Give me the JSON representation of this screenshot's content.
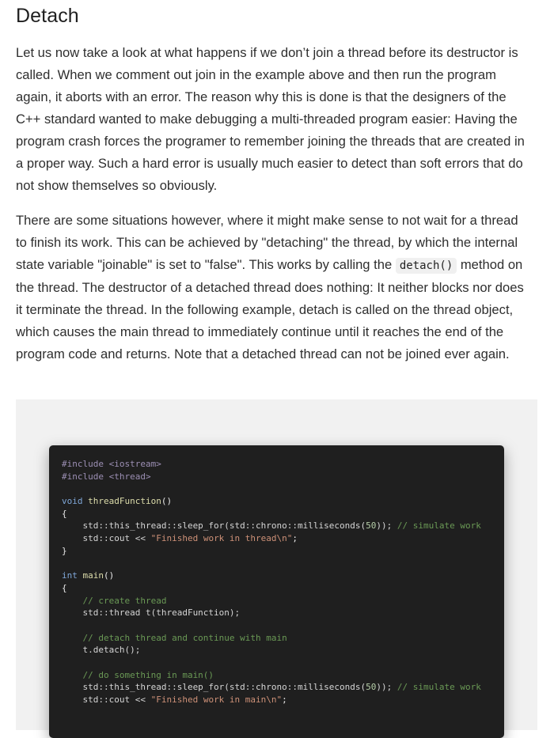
{
  "heading": "Detach",
  "paragraph1": "Let us now take a look at what happens if we don’t join a thread before its destructor is called. When we comment out join in the example above and then run the program again, it aborts with an error. The reason why this is done is that the designers of the C++ standard wanted to make debugging a multi-threaded program easier: Having the program crash forces the programer to remember joining the threads that are created in a proper way. Such a hard error is usually much easier to detect than soft errors that do not show themselves so obviously.",
  "paragraph2": {
    "before": "There are some situations however, where it might make sense to not wait for a thread to finish its work. This can be achieved by \"detaching\" the thread, by which the internal state variable \"joinable\" is set to \"false\". This works by calling the ",
    "code": "detach()",
    "after": " method on the thread. The destructor of a detached thread does nothing: It neither blocks nor does it terminate the thread. In the following example, detach is called on the thread object, which causes the main thread to immediately continue until it reaches the end of the program code and returns. Note that a detached thread can not be joined ever again."
  },
  "code_lines": [
    [
      {
        "t": "#include <iostream>",
        "c": "pp"
      }
    ],
    [
      {
        "t": "#include <thread>",
        "c": "pp"
      }
    ],
    [
      {
        "t": "",
        "c": ""
      }
    ],
    [
      {
        "t": "void",
        "c": "kw"
      },
      {
        "t": " ",
        "c": ""
      },
      {
        "t": "threadFunction",
        "c": "fn"
      },
      {
        "t": "()",
        "c": ""
      }
    ],
    [
      {
        "t": "{",
        "c": ""
      }
    ],
    [
      {
        "t": "    std::this_thread::sleep_for(std::chrono::milliseconds(",
        "c": "ns"
      },
      {
        "t": "50",
        "c": "num"
      },
      {
        "t": ")); ",
        "c": "ns"
      },
      {
        "t": "// simulate work",
        "c": "cm"
      }
    ],
    [
      {
        "t": "    std::cout << ",
        "c": "ns"
      },
      {
        "t": "\"Finished work in thread\\n\"",
        "c": "str"
      },
      {
        "t": ";",
        "c": ""
      }
    ],
    [
      {
        "t": "}",
        "c": ""
      }
    ],
    [
      {
        "t": "",
        "c": ""
      }
    ],
    [
      {
        "t": "int",
        "c": "kw"
      },
      {
        "t": " ",
        "c": ""
      },
      {
        "t": "main",
        "c": "fn"
      },
      {
        "t": "()",
        "c": ""
      }
    ],
    [
      {
        "t": "{",
        "c": ""
      }
    ],
    [
      {
        "t": "    // create thread",
        "c": "cm"
      }
    ],
    [
      {
        "t": "    std::thread t(threadFunction);",
        "c": "ns"
      }
    ],
    [
      {
        "t": "",
        "c": ""
      }
    ],
    [
      {
        "t": "    // detach thread and continue with main",
        "c": "cm"
      }
    ],
    [
      {
        "t": "    t.detach();",
        "c": "ns"
      }
    ],
    [
      {
        "t": "",
        "c": ""
      }
    ],
    [
      {
        "t": "    // do something in main()",
        "c": "cm"
      }
    ],
    [
      {
        "t": "    std::this_thread::sleep_for(std::chrono::milliseconds(",
        "c": "ns"
      },
      {
        "t": "50",
        "c": "num"
      },
      {
        "t": ")); ",
        "c": "ns"
      },
      {
        "t": "// simulate work",
        "c": "cm"
      }
    ],
    [
      {
        "t": "    std::cout << ",
        "c": "ns"
      },
      {
        "t": "\"Finished work in main\\n\"",
        "c": "str"
      },
      {
        "t": ";",
        "c": ""
      }
    ]
  ]
}
